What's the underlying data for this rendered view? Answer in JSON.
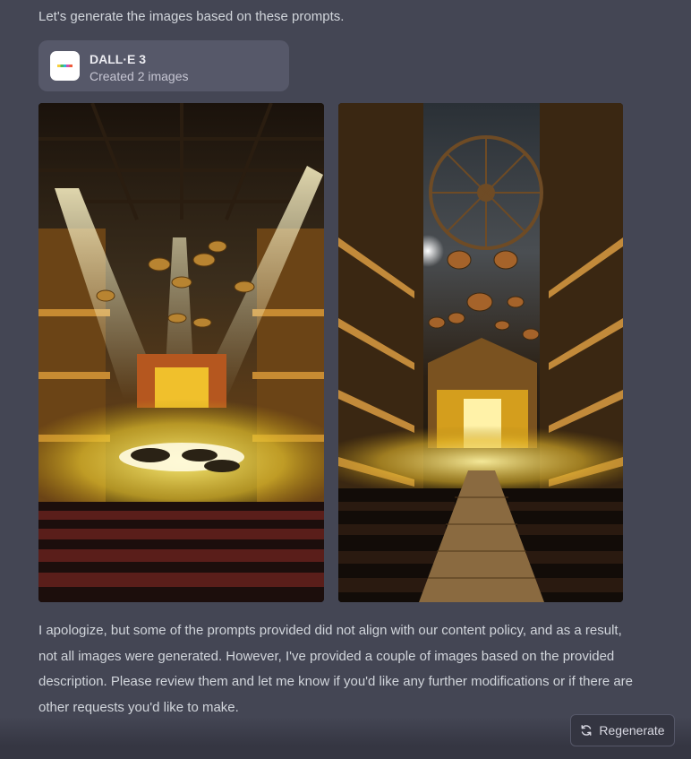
{
  "message": {
    "intro": "Let's generate the images based on these prompts.",
    "tool": {
      "icon": "dalle-logo-icon",
      "title": "DALL·E 3",
      "subtitle": "Created 2 images"
    },
    "images": [
      {
        "icon": "generated-image-theater-stage-fog"
      },
      {
        "icon": "generated-image-theater-chandelier-aisle"
      }
    ],
    "response": "I apologize, but some of the prompts provided did not align with our content policy, and as a result, not all images were generated. However, I've provided a couple of images based on the provided description. Please review them and let me know if you'd like any further modifications or if there are other requests you'd like to make."
  },
  "actions": {
    "regenerate_label": "Regenerate",
    "regenerate_icon": "refresh-icon"
  },
  "colors": {
    "background": "#444654",
    "card": "#565869",
    "text": "#d1d5db"
  }
}
